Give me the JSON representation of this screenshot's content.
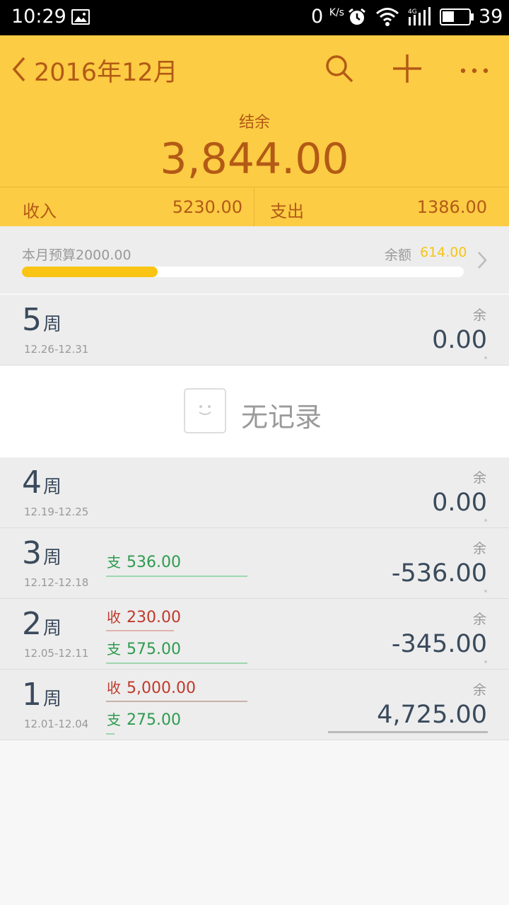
{
  "status_bar": {
    "time": "10:29",
    "net_speed": "0",
    "net_unit": "K/s",
    "network_type": "4G",
    "battery": "39"
  },
  "header": {
    "month": "2016年12月",
    "balance_label": "结余",
    "balance_value": "3,844.00",
    "income_label": "收入",
    "income_value": "5230.00",
    "expense_label": "支出",
    "expense_value": "1386.00",
    "icons": [
      "back-icon",
      "search-icon",
      "add-icon",
      "more-icon"
    ]
  },
  "budget": {
    "label": "本月预算2000.00",
    "remaining_label": "余额",
    "remaining_value": "614.00",
    "used_fraction": 0.307
  },
  "weeks": [
    {
      "num": "5",
      "unit": "周",
      "range": "12.26-12.31",
      "remain_label": "余",
      "remain": "0.00",
      "transactions": []
    },
    {
      "num": "4",
      "unit": "周",
      "range": "12.19-12.25",
      "remain_label": "余",
      "remain": "0.00",
      "transactions": []
    },
    {
      "num": "3",
      "unit": "周",
      "range": "12.12-12.18",
      "remain_label": "余",
      "remain": "-536.00",
      "transactions": [
        {
          "kind": "支",
          "amount": "536.00"
        }
      ]
    },
    {
      "num": "2",
      "unit": "周",
      "range": "12.05-12.11",
      "remain_label": "余",
      "remain": "-345.00",
      "transactions": [
        {
          "kind": "收",
          "amount": "230.00"
        },
        {
          "kind": "支",
          "amount": "575.00"
        }
      ]
    },
    {
      "num": "1",
      "unit": "周",
      "range": "12.01-12.04",
      "remain_label": "余",
      "remain": "4,725.00",
      "transactions": [
        {
          "kind": "收",
          "amount": "5,000.00"
        },
        {
          "kind": "支",
          "amount": "275.00"
        }
      ]
    }
  ],
  "empty_state": {
    "text": "无记录"
  },
  "colors": {
    "header_bg": "#fccc44",
    "header_text": "#b35a16",
    "budget_fill": "#f9c414",
    "income": "#c0392b",
    "expense": "#2e9b4e"
  }
}
